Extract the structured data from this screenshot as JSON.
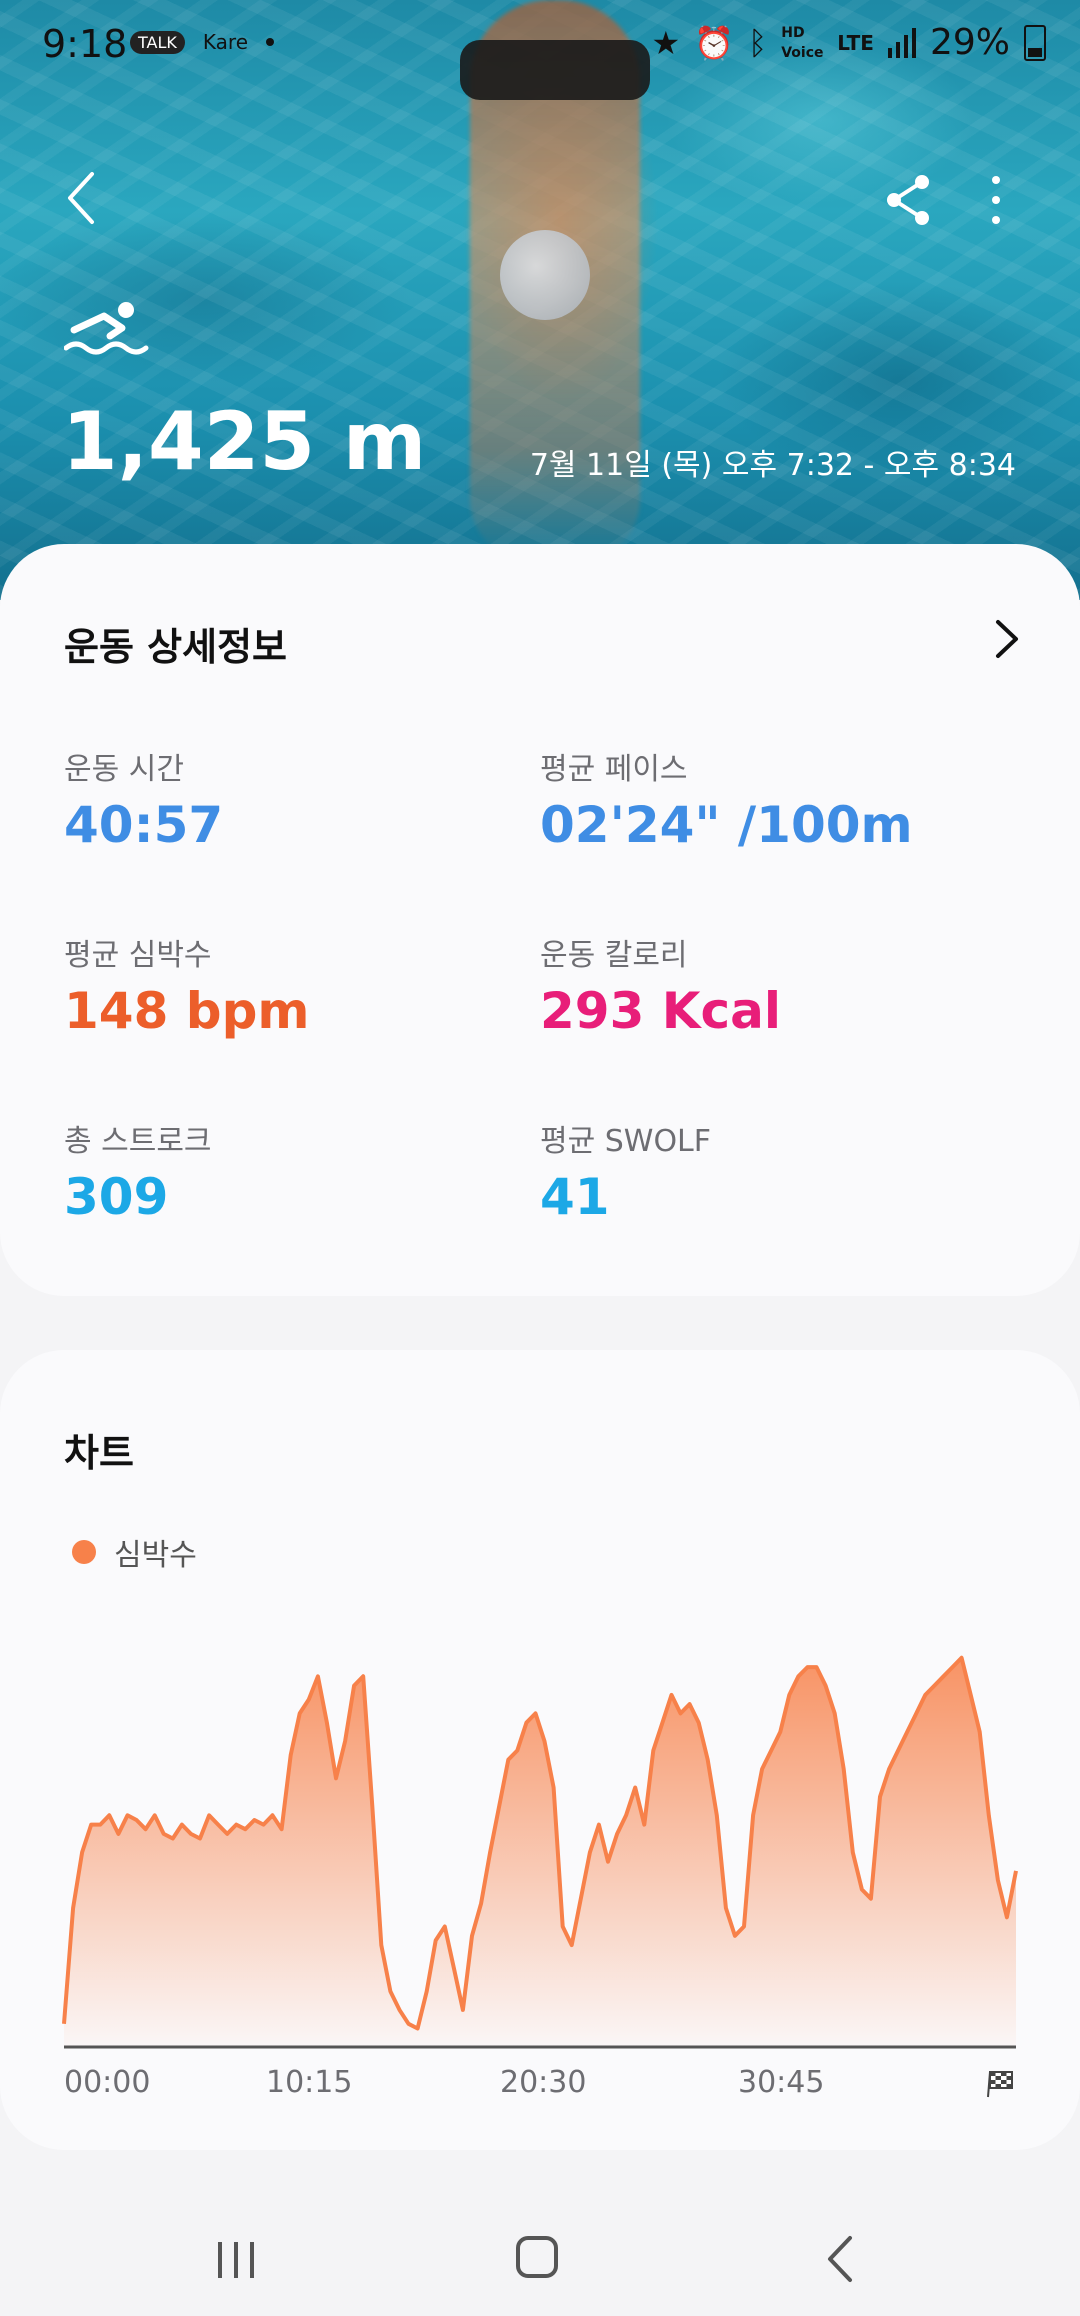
{
  "status_bar": {
    "time": "9:18",
    "notifications": [
      "TALK",
      "Kare"
    ],
    "signal_label": "LTE",
    "voice_label": "HD Voice",
    "battery": "29%"
  },
  "header": {
    "distance": "1,425 m",
    "date_range": "7월 11일 (목) 오후 7:32 - 오후 8:34",
    "activity_icon": "swimming-icon"
  },
  "details": {
    "title": "운동 상세정보",
    "metrics": [
      {
        "label": "운동 시간",
        "value": "40:57",
        "color": "#3f8de4"
      },
      {
        "label": "평균 페이스",
        "value": "02'24\" /100m",
        "color": "#3f8de4"
      },
      {
        "label": "평균 심박수",
        "value": "148 bpm",
        "color": "#ec5e2a"
      },
      {
        "label": "운동 칼로리",
        "value": "293 Kcal",
        "color": "#e81e79"
      },
      {
        "label": "총 스트로크",
        "value": "309",
        "color": "#1ca8e6"
      },
      {
        "label": "평균 SWOLF",
        "value": "41",
        "color": "#1ca8e6"
      }
    ]
  },
  "chart_section": {
    "title": "차트",
    "legend": "심박수"
  },
  "chart_data": {
    "type": "area",
    "x_ticks": [
      "00:00",
      "10:15",
      "20:30",
      "30:45"
    ],
    "series": [
      {
        "name": "심박수",
        "color": "#f7814a",
        "values": [
          105,
          130,
          142,
          148,
          148,
          150,
          146,
          150,
          149,
          147,
          150,
          146,
          145,
          148,
          146,
          145,
          150,
          148,
          146,
          148,
          147,
          149,
          148,
          150,
          147,
          163,
          172,
          175,
          180,
          170,
          158,
          166,
          178,
          180,
          152,
          122,
          112,
          108,
          105,
          104,
          112,
          123,
          126,
          117,
          108,
          124,
          131,
          142,
          152,
          162,
          164,
          170,
          172,
          166,
          156,
          126,
          122,
          132,
          142,
          148,
          140,
          146,
          150,
          156,
          148,
          164,
          170,
          176,
          172,
          174,
          170,
          162,
          150,
          130,
          124,
          126,
          150,
          160,
          164,
          168,
          176,
          180,
          182,
          182,
          178,
          172,
          160,
          142,
          134,
          132,
          154,
          160,
          164,
          168,
          172,
          176,
          178,
          180,
          182,
          184,
          176,
          168,
          150,
          136,
          128,
          138
        ],
        "y_range": [
          100,
          190
        ]
      }
    ]
  },
  "navbar": {
    "recent_label": "recent-apps",
    "home_label": "home",
    "back_label": "back"
  }
}
